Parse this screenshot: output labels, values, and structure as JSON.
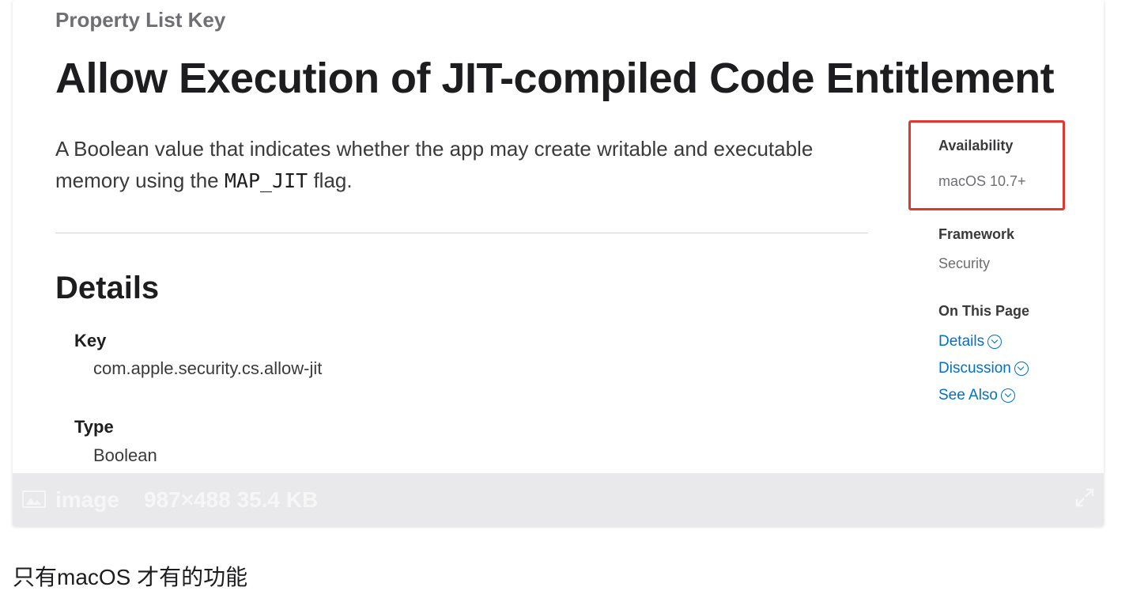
{
  "document": {
    "eyebrow": "Property List Key",
    "title": "Allow Execution of JIT-compiled Code Entitlement",
    "abstract_before": "A Boolean value that indicates whether the app may create writable and executable memory using the ",
    "abstract_code": "MAP_JIT",
    "abstract_after": " flag.",
    "details_heading": "Details",
    "params": [
      {
        "name": "Key",
        "value": "com.apple.security.cs.allow-jit"
      },
      {
        "name": "Type",
        "value": "Boolean"
      }
    ]
  },
  "sidebar": {
    "availability_title": "Availability",
    "availability_value": "macOS 10.7+",
    "framework_title": "Framework",
    "framework_value": "Security",
    "on_this_page_title": "On This Page",
    "links": [
      {
        "label": "Details",
        "icon": "chevron-circle-down-icon"
      },
      {
        "label": "Discussion",
        "icon": "chevron-circle-down-icon"
      },
      {
        "label": "See Also",
        "icon": "chevron-circle-down-icon"
      }
    ],
    "highlight_color": "#e0382e"
  },
  "image_bar": {
    "label": "image",
    "meta": "987×488 35.4 KB",
    "icon": "image-icon",
    "expand_icon": "expand-icon"
  },
  "caption": "只有macOS 才有的功能",
  "colors": {
    "link": "#0070c9",
    "text": "#1d1d1f",
    "secondary": "#6e6e73"
  }
}
